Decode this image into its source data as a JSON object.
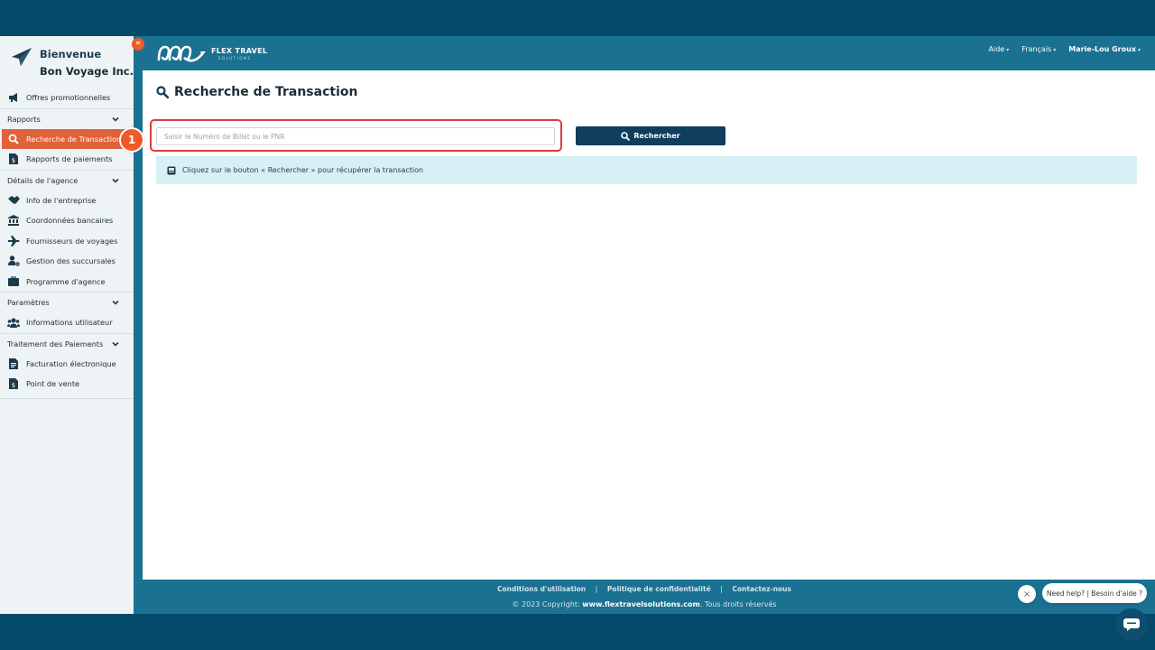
{
  "sidebar": {
    "welcome": "Bienvenue",
    "company": "Bon Voyage Inc.",
    "items": [
      {
        "label": "Offres promotionnelles",
        "icon": "megaphone-icon"
      },
      {
        "label": "Rapports",
        "type": "section"
      },
      {
        "label": "Recherche de Transaction",
        "icon": "search-icon",
        "active": true
      },
      {
        "label": "Rapports de paiements",
        "icon": "file-dollar-icon"
      },
      {
        "label": "Détails de l'agence",
        "type": "section"
      },
      {
        "label": "Info de l'entreprise",
        "icon": "handshake-icon"
      },
      {
        "label": "Coordonnées bancaires",
        "icon": "bank-icon"
      },
      {
        "label": "Fournisseurs de voyages",
        "icon": "airplane-icon"
      },
      {
        "label": "Gestion des succursales",
        "icon": "user-gear-icon"
      },
      {
        "label": "Programme d'agence",
        "icon": "briefcase-icon"
      },
      {
        "label": "Paramètres",
        "type": "section"
      },
      {
        "label": "Informations utilisateur",
        "icon": "users-icon"
      },
      {
        "label": "Traitement des Paiements",
        "type": "section"
      },
      {
        "label": "Facturation électronique",
        "icon": "invoice-icon"
      },
      {
        "label": "Point de vente",
        "icon": "file-dollar-icon"
      }
    ]
  },
  "header": {
    "logo_text": "FLEX TRAVEL",
    "logo_subtext": "SOLUTIONS",
    "help": "Aide",
    "language": "Français",
    "user": "Marie-Lou Groux"
  },
  "main": {
    "title": "Recherche de Transaction",
    "search_placeholder": "Saisir le Numéro de Billet ou le PNR",
    "search_button": "Rechercher",
    "info_text": "Cliquez sur le bouton « Rechercher » pour récupérer la transaction"
  },
  "step_badge": "1",
  "help_widget": {
    "text": "Need help? | Besoin d'aide ?",
    "close": "×"
  },
  "footer": {
    "terms": "Conditions d'utilisation",
    "privacy": "Politique de confidentialité",
    "contact": "Contactez-nous",
    "copyright_prefix": "© 2023 Copyright:",
    "site": "www.flextravelsolutions.com",
    "rights": ". Tous droits réservés"
  },
  "colors": {
    "accent": "#e0613a",
    "navy": "#0e3e5c",
    "topbar": "#1a7191",
    "highlight": "#e03a3a"
  }
}
